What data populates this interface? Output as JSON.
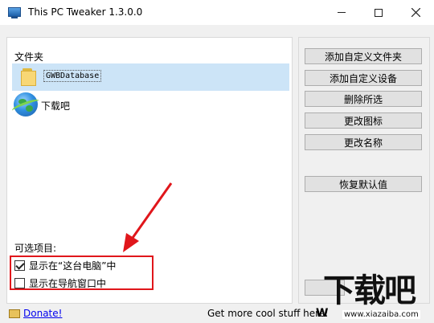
{
  "window": {
    "title": "This PC Tweaker 1.3.0.0",
    "controls": {
      "minimize": "minimize",
      "maximize": "maximize",
      "close": "close"
    }
  },
  "folders": {
    "label": "文件夹",
    "items": [
      {
        "name": "GWBDatabase",
        "icon": "folder-icon",
        "selected": true
      },
      {
        "name": "下载吧",
        "icon": "globe-icon",
        "selected": false
      }
    ]
  },
  "options": {
    "label": "可选项目:",
    "items": [
      {
        "label": "显示在“这台电脑”中",
        "checked": true
      },
      {
        "label": "显示在导航窗口中",
        "checked": false
      }
    ]
  },
  "actions": {
    "add_folder": "添加自定义文件夹",
    "add_device": "添加自定义设备",
    "delete_selected": "删除所选",
    "change_icon": "更改图标",
    "change_name": "更改名称",
    "restore_default": "恢复默认值"
  },
  "footer": {
    "donate": "Donate!",
    "more_text": "Get more cool stuff here:",
    "more_logo": "W"
  },
  "watermark": {
    "text": "下载吧",
    "url": "www.xiazaiba.com"
  },
  "colors": {
    "selection": "#cce4f7",
    "highlight_box": "#e0161b",
    "arrow": "#e0161b"
  }
}
